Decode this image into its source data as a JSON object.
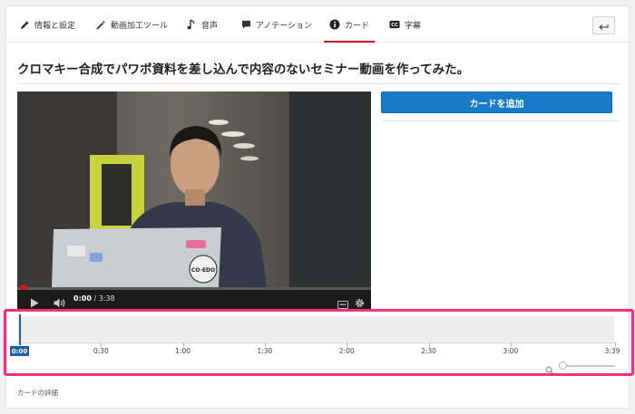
{
  "tabs": [
    {
      "label": "情報と設定",
      "icon": "pencil-icon"
    },
    {
      "label": "動画加工ツール",
      "icon": "magic-wand-icon"
    },
    {
      "label": "音声",
      "icon": "music-note-icon"
    },
    {
      "label": "アノテーション",
      "icon": "speech-bubble-icon"
    },
    {
      "label": "カード",
      "icon": "info-icon",
      "active": true
    },
    {
      "label": "字幕",
      "icon": "cc-icon"
    }
  ],
  "back_icon": "back-arrow-icon",
  "video_title": "クロマキー合成でパワポ資料を差し込んで内容のないセミナー動画を作ってみた。",
  "player": {
    "current_time": "0:00",
    "duration": "3:38",
    "progress_fraction": 0.0,
    "laptop_sticker": "CO-EDO"
  },
  "add_card_label": "カードを追加",
  "timeline": {
    "current_time": "0:00",
    "ticks": [
      "0:30",
      "1:00",
      "1:30",
      "2:00",
      "2:30",
      "3:00",
      "3:39"
    ],
    "zoom_level": 0.0
  },
  "card_details_label": "カードの詳細",
  "colors": {
    "accent_blue": "#167ac6",
    "active_tab_red": "#cc181e",
    "highlight_pink": "#f0337a"
  }
}
